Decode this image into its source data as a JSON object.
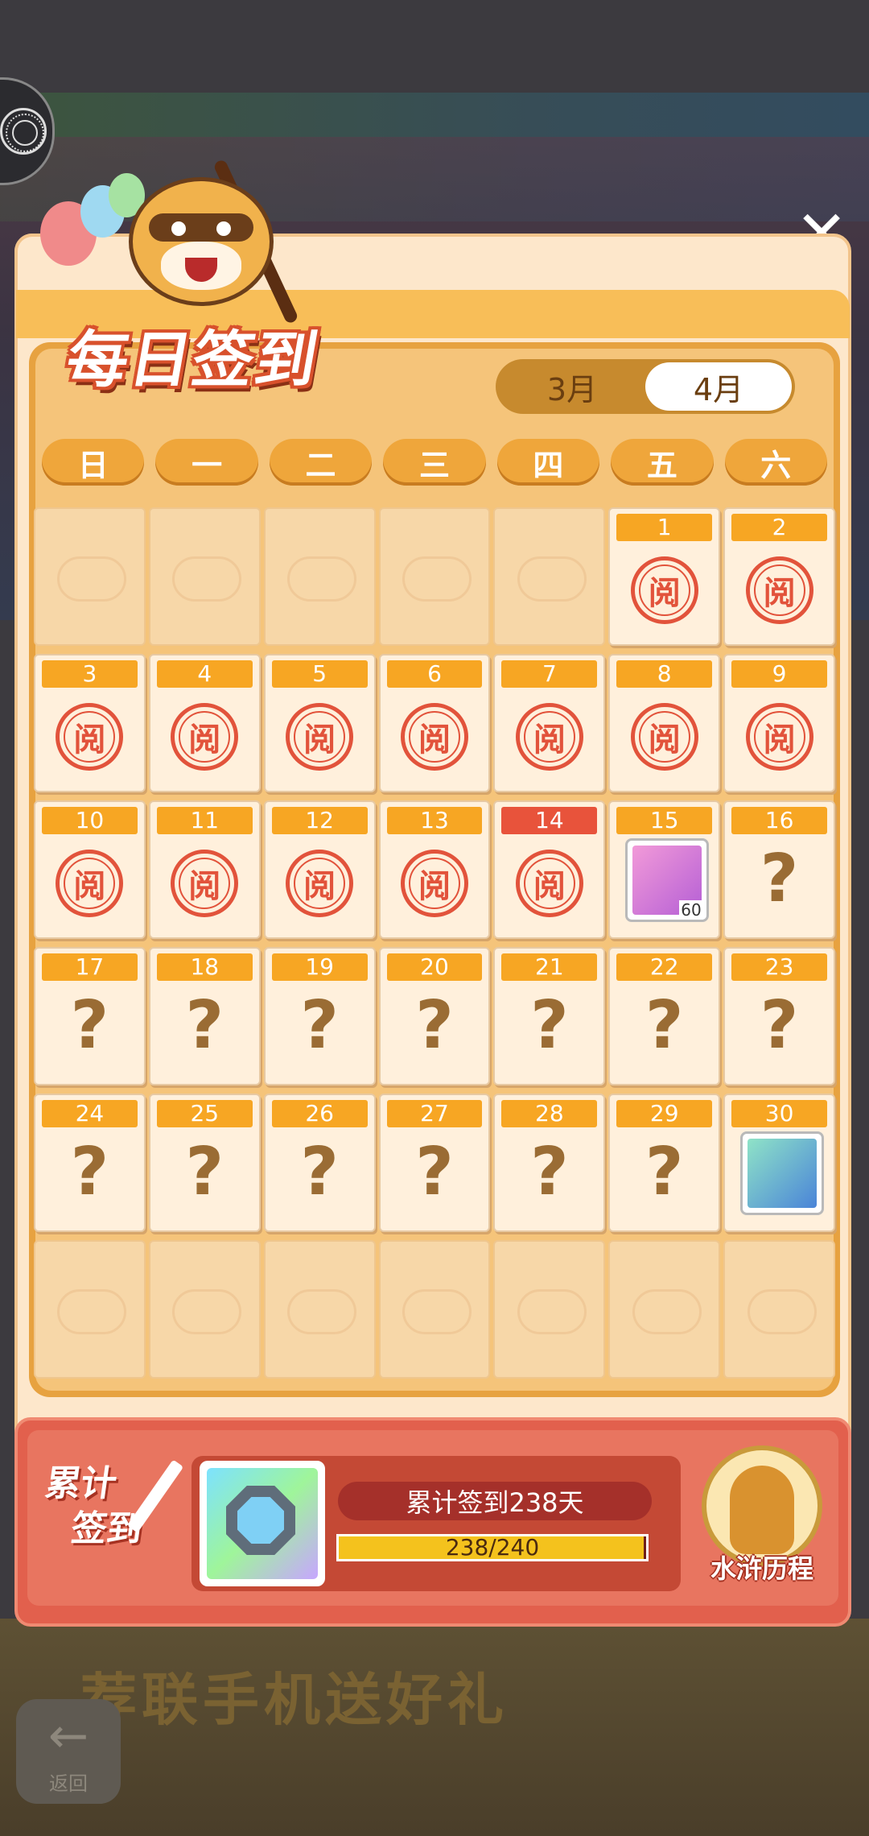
{
  "header": {
    "title": "每日签到",
    "close_symbol": "✕"
  },
  "months": [
    {
      "label": "3月",
      "active": false
    },
    {
      "label": "4月",
      "active": true
    }
  ],
  "weekdays": [
    "日",
    "一",
    "二",
    "三",
    "四",
    "五",
    "六"
  ],
  "days": [
    {
      "type": "empty"
    },
    {
      "type": "empty"
    },
    {
      "type": "empty"
    },
    {
      "type": "empty"
    },
    {
      "type": "empty"
    },
    {
      "type": "read",
      "day": "1"
    },
    {
      "type": "read",
      "day": "2"
    },
    {
      "type": "read",
      "day": "3"
    },
    {
      "type": "read",
      "day": "4"
    },
    {
      "type": "read",
      "day": "5"
    },
    {
      "type": "read",
      "day": "6"
    },
    {
      "type": "read",
      "day": "7"
    },
    {
      "type": "read",
      "day": "8"
    },
    {
      "type": "read",
      "day": "9"
    },
    {
      "type": "read",
      "day": "10"
    },
    {
      "type": "read",
      "day": "11"
    },
    {
      "type": "read",
      "day": "12"
    },
    {
      "type": "read",
      "day": "13"
    },
    {
      "type": "read",
      "day": "14",
      "today": true
    },
    {
      "type": "reward",
      "day": "15",
      "reward": "ticket-icon",
      "qty": "60"
    },
    {
      "type": "unknown",
      "day": "16"
    },
    {
      "type": "unknown",
      "day": "17"
    },
    {
      "type": "unknown",
      "day": "18"
    },
    {
      "type": "unknown",
      "day": "19"
    },
    {
      "type": "unknown",
      "day": "20"
    },
    {
      "type": "unknown",
      "day": "21"
    },
    {
      "type": "unknown",
      "day": "22"
    },
    {
      "type": "unknown",
      "day": "23"
    },
    {
      "type": "unknown",
      "day": "24"
    },
    {
      "type": "unknown",
      "day": "25"
    },
    {
      "type": "unknown",
      "day": "26"
    },
    {
      "type": "unknown",
      "day": "27"
    },
    {
      "type": "unknown",
      "day": "28"
    },
    {
      "type": "unknown",
      "day": "29"
    },
    {
      "type": "reward",
      "day": "30",
      "reward": "energy-tube-icon",
      "qty": ""
    },
    {
      "type": "empty"
    },
    {
      "type": "empty"
    },
    {
      "type": "empty"
    },
    {
      "type": "empty"
    },
    {
      "type": "empty"
    },
    {
      "type": "empty"
    },
    {
      "type": "empty"
    }
  ],
  "stamp_text": "阅",
  "unknown_text": "?",
  "cumulative": {
    "label_line1": "累计",
    "label_line2": "签到",
    "title": "累计签到238天",
    "progress_text": "238/240",
    "progress_value": 238,
    "progress_max": 240,
    "reward_icon": "crystal-gem-icon"
  },
  "history_button": "水浒历程",
  "background": {
    "banner_text": "荐联手机送好礼",
    "back_small": "返回"
  },
  "colors": {
    "accent": "#f7a623",
    "today": "#e8533b",
    "stamp": "#e2533b",
    "progress_fill": "#f4c21d"
  }
}
